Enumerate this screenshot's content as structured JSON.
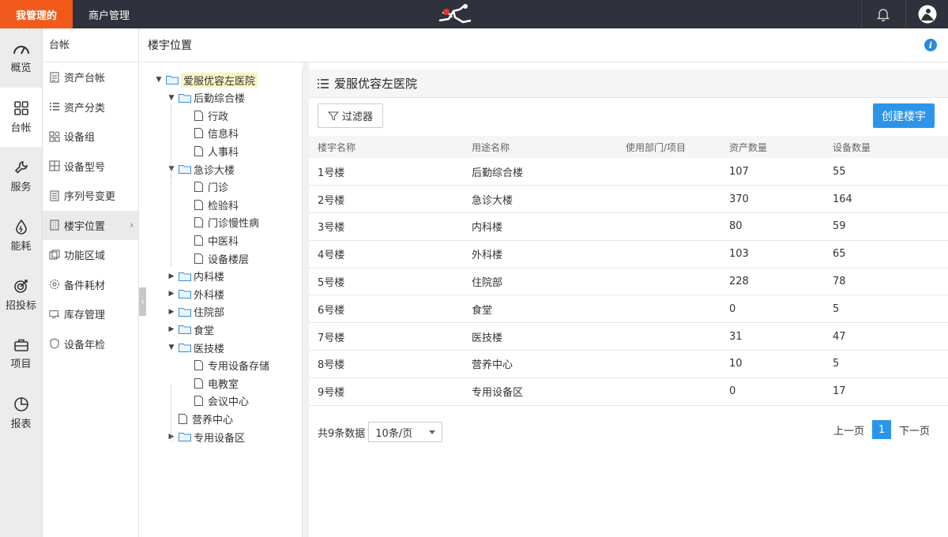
{
  "topbar": {
    "tab_mine": "我管理的",
    "tab_merchant": "商户管理"
  },
  "rail": [
    {
      "label": "概览",
      "icon": "gauge-icon"
    },
    {
      "label": "台帐",
      "icon": "grid-icon"
    },
    {
      "label": "服务",
      "icon": "wrench-icon"
    },
    {
      "label": "能耗",
      "icon": "drop-icon"
    },
    {
      "label": "招投标",
      "icon": "target-icon"
    },
    {
      "label": "项目",
      "icon": "briefcase-icon"
    },
    {
      "label": "报表",
      "icon": "pie-icon"
    }
  ],
  "subnav": {
    "title": "台帐",
    "items": [
      {
        "label": "资产台帐",
        "icon": "doc-icon"
      },
      {
        "label": "资产分类",
        "icon": "list-icon"
      },
      {
        "label": "设备组",
        "icon": "group-icon"
      },
      {
        "label": "设备型号",
        "icon": "layout-icon"
      },
      {
        "label": "序列号变更",
        "icon": "serial-icon"
      },
      {
        "label": "楼宇位置",
        "icon": "building-icon"
      },
      {
        "label": "功能区域",
        "icon": "area-icon"
      },
      {
        "label": "备件耗材",
        "icon": "gear-icon"
      },
      {
        "label": "库存管理",
        "icon": "monitor-icon"
      },
      {
        "label": "设备年检",
        "icon": "shield-icon"
      }
    ]
  },
  "page": {
    "title": "楼宇位置"
  },
  "tree": {
    "root": "爱服优容左医院",
    "nodes": [
      {
        "label": "后勤综合楼"
      },
      {
        "label": "行政"
      },
      {
        "label": "信息科"
      },
      {
        "label": "人事科"
      },
      {
        "label": "急诊大楼"
      },
      {
        "label": "门诊"
      },
      {
        "label": "检验科"
      },
      {
        "label": "门诊慢性病"
      },
      {
        "label": "中医科"
      },
      {
        "label": "设备楼层"
      },
      {
        "label": "内科楼"
      },
      {
        "label": "外科楼"
      },
      {
        "label": "住院部"
      },
      {
        "label": "食堂"
      },
      {
        "label": "医技楼"
      },
      {
        "label": "专用设备存储"
      },
      {
        "label": "电教室"
      },
      {
        "label": "会议中心"
      },
      {
        "label": "营养中心"
      },
      {
        "label": "专用设备区"
      }
    ]
  },
  "main": {
    "title": "爱服优容左医院",
    "filter_label": "过滤器",
    "create_label": "创建楼宇",
    "columns": [
      "楼宇名称",
      "用途名称",
      "使用部门/项目",
      "资产数量",
      "设备数量"
    ],
    "rows": [
      [
        "1号楼",
        "后勤综合楼",
        "",
        "107",
        "55"
      ],
      [
        "2号楼",
        "急诊大楼",
        "",
        "370",
        "164"
      ],
      [
        "3号楼",
        "内科楼",
        "",
        "80",
        "59"
      ],
      [
        "4号楼",
        "外科楼",
        "",
        "103",
        "65"
      ],
      [
        "5号楼",
        "住院部",
        "",
        "228",
        "78"
      ],
      [
        "6号楼",
        "食堂",
        "",
        "0",
        "5"
      ],
      [
        "7号楼",
        "医技楼",
        "",
        "31",
        "47"
      ],
      [
        "8号楼",
        "营养中心",
        "",
        "10",
        "5"
      ],
      [
        "9号楼",
        "专用设备区",
        "",
        "0",
        "17"
      ]
    ],
    "total_text": "共9条数据",
    "page_size": "10条/页",
    "prev_label": "上一页",
    "current_page": "1",
    "next_label": "下一页"
  },
  "colors": {
    "accent_orange": "#f05a1a",
    "primary_blue": "#2d95e8",
    "topbar_bg": "#2f323c"
  }
}
